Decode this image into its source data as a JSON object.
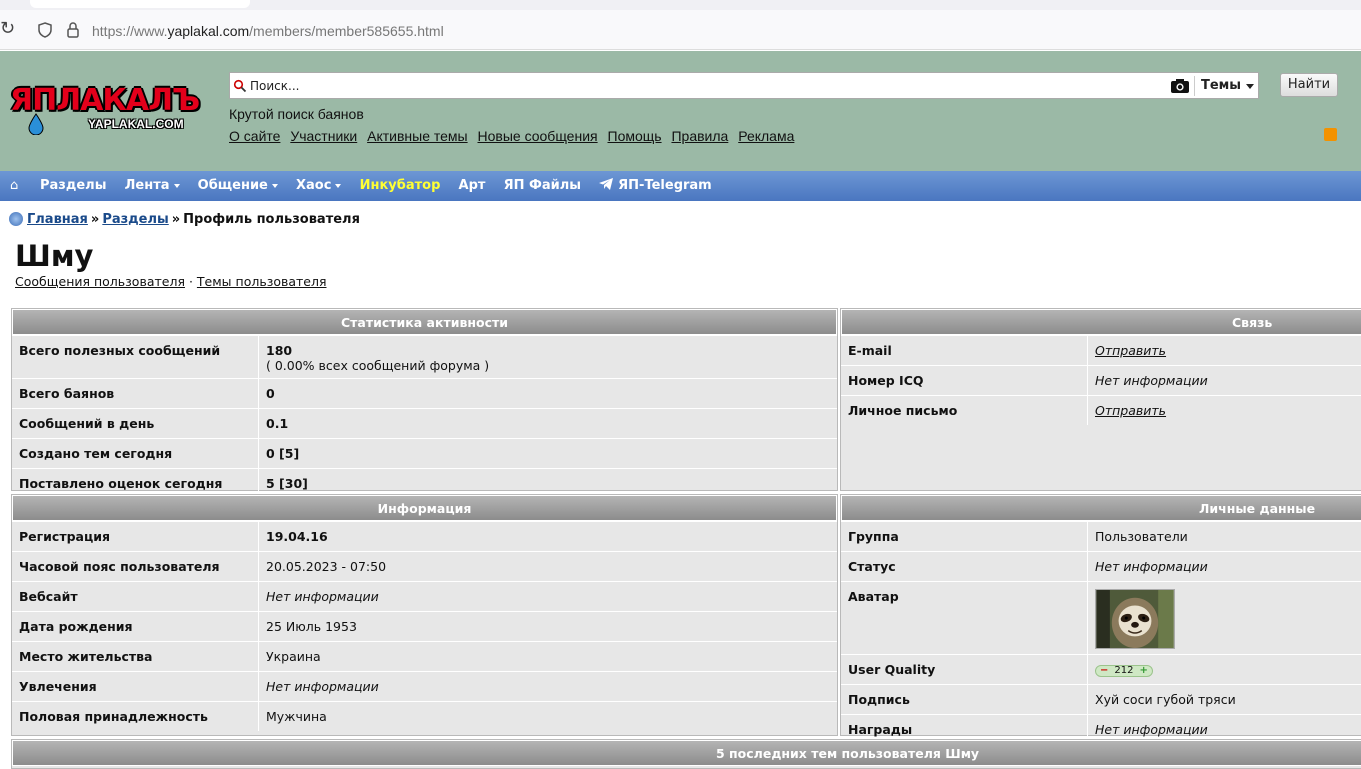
{
  "browser": {
    "url_prefix": "https://www.",
    "url_host": "yaplakal.com",
    "url_path": "/members/member585655.html"
  },
  "logo": {
    "big": "ЯПЛАКАЛЪ",
    "small": "YAPLAKAL.COM"
  },
  "search": {
    "placeholder": "Поиск...",
    "scope": "Темы",
    "button": "Найти"
  },
  "tagline": "Крутой поиск баянов",
  "toplinks": [
    "О сайте",
    "Участники",
    "Активные темы",
    "Новые сообщения",
    "Помощь",
    "Правила",
    "Реклама"
  ],
  "nav": {
    "home_icon": "home-icon",
    "items": [
      {
        "label": "Разделы"
      },
      {
        "label": "Лента"
      },
      {
        "label": "Общение"
      },
      {
        "label": "Хаос"
      },
      {
        "label": "Инкубатор"
      },
      {
        "label": "Арт"
      },
      {
        "label": "ЯП Файлы"
      },
      {
        "label": "ЯП-Telegram"
      }
    ],
    "highlight_color": "#ffff33"
  },
  "breadcrumb": {
    "home": "Главная",
    "sections": "Разделы",
    "sep": "»",
    "current": "Профиль пользователя"
  },
  "profile": {
    "name": "Шму",
    "link_posts": "Сообщения пользователя",
    "link_sep": "·",
    "link_topics": "Темы пользователя"
  },
  "stats": {
    "title": "Статистика активности",
    "rows": [
      {
        "k": "Всего полезных сообщений",
        "v": "180",
        "sub": "( 0.00% всех сообщений форума )"
      },
      {
        "k": "Всего баянов",
        "v": "0"
      },
      {
        "k": "Сообщений в день",
        "v": "0.1"
      },
      {
        "k": "Создано тем сегодня",
        "v": "0 [5]"
      },
      {
        "k": "Поставлено оценок сегодня",
        "v": "5 [30]"
      }
    ]
  },
  "contact": {
    "title": "Связь",
    "rows": [
      {
        "k": "E-mail",
        "v": "Отправить"
      },
      {
        "k": "Номер ICQ",
        "v": "Нет информации"
      },
      {
        "k": "Личное письмо",
        "v": "Отправить"
      }
    ]
  },
  "info": {
    "title": "Информация",
    "rows": [
      {
        "k": "Регистрация",
        "v": "19.04.16"
      },
      {
        "k": "Часовой пояс пользователя",
        "v": "20.05.2023 - 07:50"
      },
      {
        "k": "Вебсайт",
        "v": "Нет информации"
      },
      {
        "k": "Дата рождения",
        "v": "25 Июль 1953"
      },
      {
        "k": "Место жительства",
        "v": "Украина"
      },
      {
        "k": "Увлечения",
        "v": "Нет информации"
      },
      {
        "k": "Половая принадлежность",
        "v": "Мужчина"
      }
    ]
  },
  "personal": {
    "title": "Личные данные",
    "rows": [
      {
        "k": "Группа",
        "v": "Пользователи"
      },
      {
        "k": "Статус",
        "v": "Нет информации"
      },
      {
        "k": "Аватар",
        "v": "sloth-avatar"
      },
      {
        "k": "User Quality",
        "v": "212"
      },
      {
        "k": "Подпись",
        "v": "Хуй соси губой тряси"
      },
      {
        "k": "Награды",
        "v": "Нет информации"
      }
    ]
  },
  "last_topics": {
    "title": "5 последних тем пользователя Шму"
  }
}
